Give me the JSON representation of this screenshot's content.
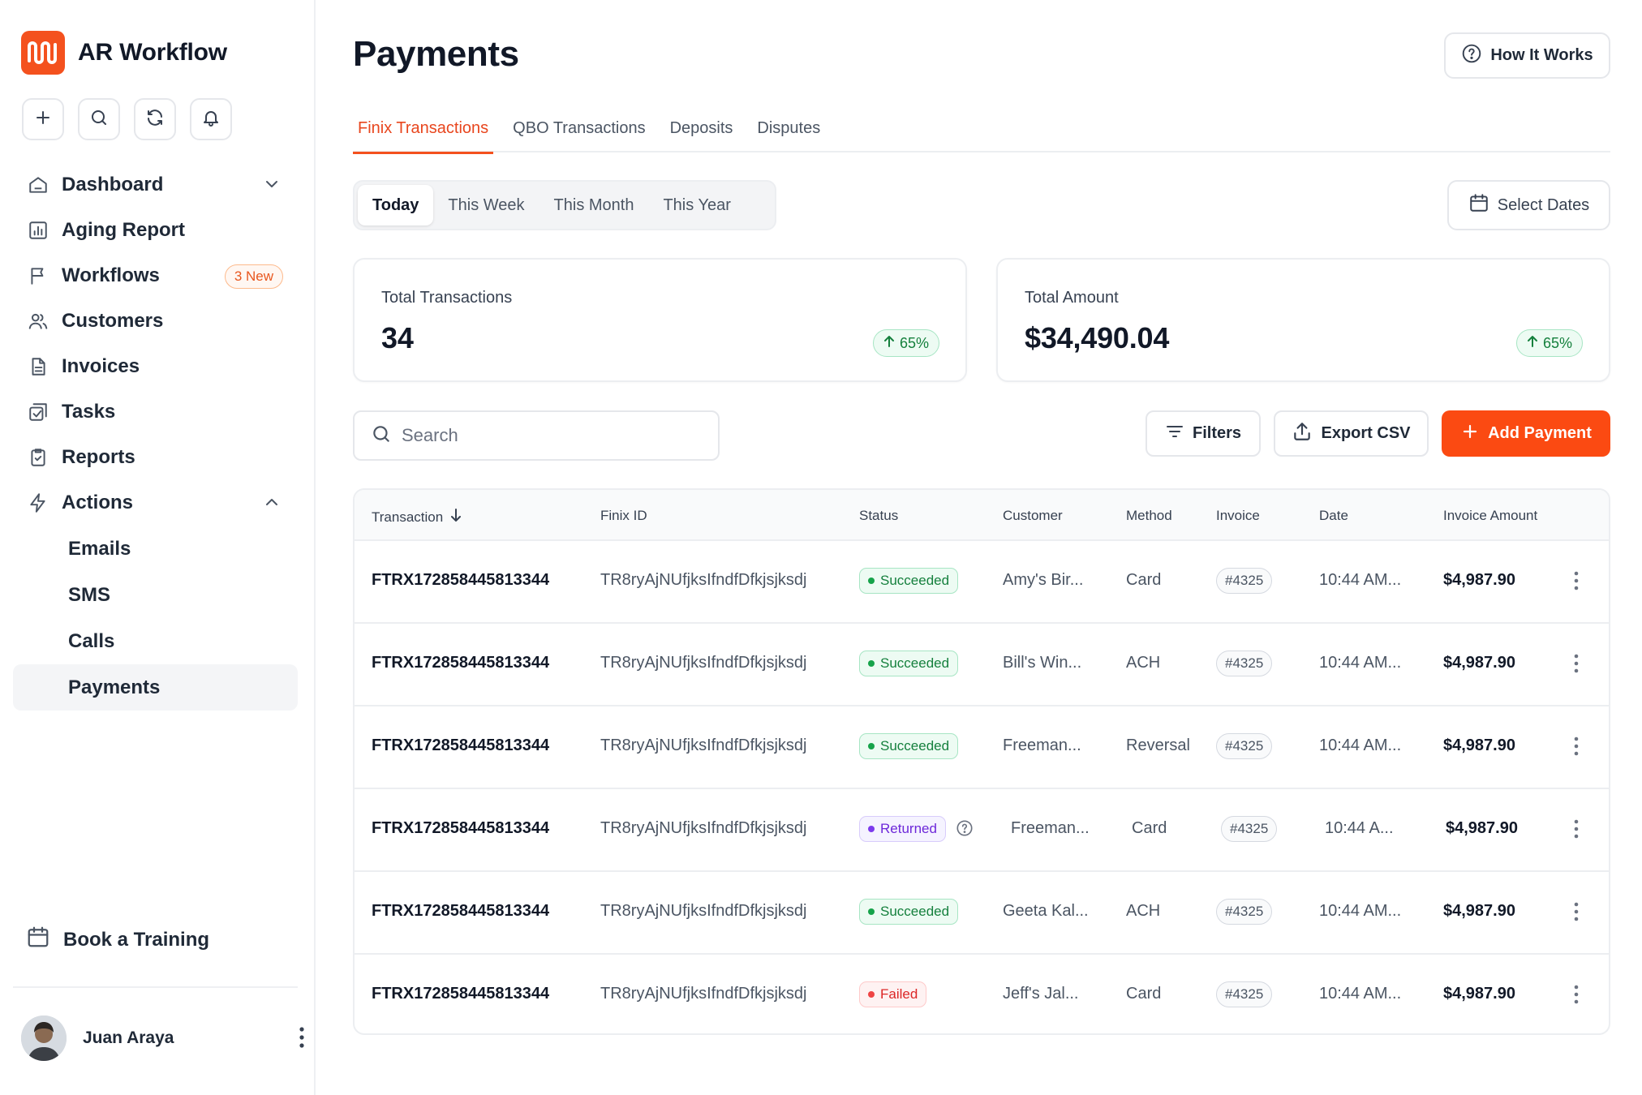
{
  "app": {
    "name": "AR Workflow",
    "brand_color": "#f4511e"
  },
  "quick_actions": [
    {
      "icon": "plus-icon"
    },
    {
      "icon": "search-icon"
    },
    {
      "icon": "refresh-icon"
    },
    {
      "icon": "bell-icon"
    }
  ],
  "sidebar": {
    "items": [
      {
        "label": "Dashboard",
        "icon": "home-icon",
        "chevron": "down"
      },
      {
        "label": "Aging Report",
        "icon": "bar-chart-icon"
      },
      {
        "label": "Workflows",
        "icon": "flag-icon",
        "badge": "3 New"
      },
      {
        "label": "Customers",
        "icon": "users-icon"
      },
      {
        "label": "Invoices",
        "icon": "document-icon"
      },
      {
        "label": "Tasks",
        "icon": "tasks-icon"
      },
      {
        "label": "Reports",
        "icon": "clipboard-check-icon"
      },
      {
        "label": "Actions",
        "icon": "lightning-icon",
        "chevron": "up"
      }
    ],
    "sub_items": [
      {
        "label": "Emails"
      },
      {
        "label": "SMS"
      },
      {
        "label": "Calls"
      },
      {
        "label": "Payments",
        "active": true
      }
    ],
    "training": "Book a Training",
    "user": {
      "name": "Juan Araya"
    }
  },
  "page": {
    "title": "Payments",
    "how_it_works": "How It Works",
    "tabs": [
      {
        "label": "Finix Transactions",
        "active": true
      },
      {
        "label": "QBO Transactions"
      },
      {
        "label": "Deposits"
      },
      {
        "label": "Disputes"
      }
    ],
    "periods": [
      {
        "label": "Today",
        "active": true
      },
      {
        "label": "This Week"
      },
      {
        "label": "This Month"
      },
      {
        "label": "This Year"
      }
    ],
    "select_dates": "Select Dates",
    "stats": [
      {
        "label": "Total Transactions",
        "value": "34",
        "change": "65%"
      },
      {
        "label": "Total Amount",
        "value": "$34,490.04",
        "change": "65%"
      }
    ],
    "search": {
      "placeholder": "Search"
    },
    "filters": "Filters",
    "export": "Export CSV",
    "add_payment": "Add Payment"
  },
  "table": {
    "columns": [
      "Transaction",
      "Finix ID",
      "Status",
      "Customer",
      "Method",
      "Invoice",
      "Date",
      "Invoice Amount"
    ],
    "rows": [
      {
        "transaction": "FTRX172858445813344",
        "finix_id": "TR8ryAjNUfjksIfndfDfkjsjksdj",
        "status": "Succeeded",
        "customer": "Amy's Bir...",
        "method": "Card",
        "invoice": "#4325",
        "date": "10:44 AM...",
        "amount": "$4,987.90"
      },
      {
        "transaction": "FTRX172858445813344",
        "finix_id": "TR8ryAjNUfjksIfndfDfkjsjksdj",
        "status": "Succeeded",
        "customer": "Bill's Win...",
        "method": "ACH",
        "invoice": "#4325",
        "date": "10:44 AM...",
        "amount": "$4,987.90"
      },
      {
        "transaction": "FTRX172858445813344",
        "finix_id": "TR8ryAjNUfjksIfndfDfkjsjksdj",
        "status": "Succeeded",
        "customer": "Freeman...",
        "method": "Reversal",
        "invoice": "#4325",
        "date": "10:44 AM...",
        "amount": "$4,987.90"
      },
      {
        "transaction": "FTRX172858445813344",
        "finix_id": "TR8ryAjNUfjksIfndfDfkjsjksdj",
        "status": "Returned",
        "customer": "Freeman...",
        "method": "Card",
        "invoice": "#4325",
        "date": "10:44 A...",
        "amount": "$4,987.90"
      },
      {
        "transaction": "FTRX172858445813344",
        "finix_id": "TR8ryAjNUfjksIfndfDfkjsjksdj",
        "status": "Succeeded",
        "customer": "Geeta Kal...",
        "method": "ACH",
        "invoice": "#4325",
        "date": "10:44 AM...",
        "amount": "$4,987.90"
      },
      {
        "transaction": "FTRX172858445813344",
        "finix_id": "TR8ryAjNUfjksIfndfDfkjsjksdj",
        "status": "Failed",
        "customer": "Jeff's Jal...",
        "method": "Card",
        "invoice": "#4325",
        "date": "10:44 AM...",
        "amount": "$4,987.90"
      }
    ]
  }
}
